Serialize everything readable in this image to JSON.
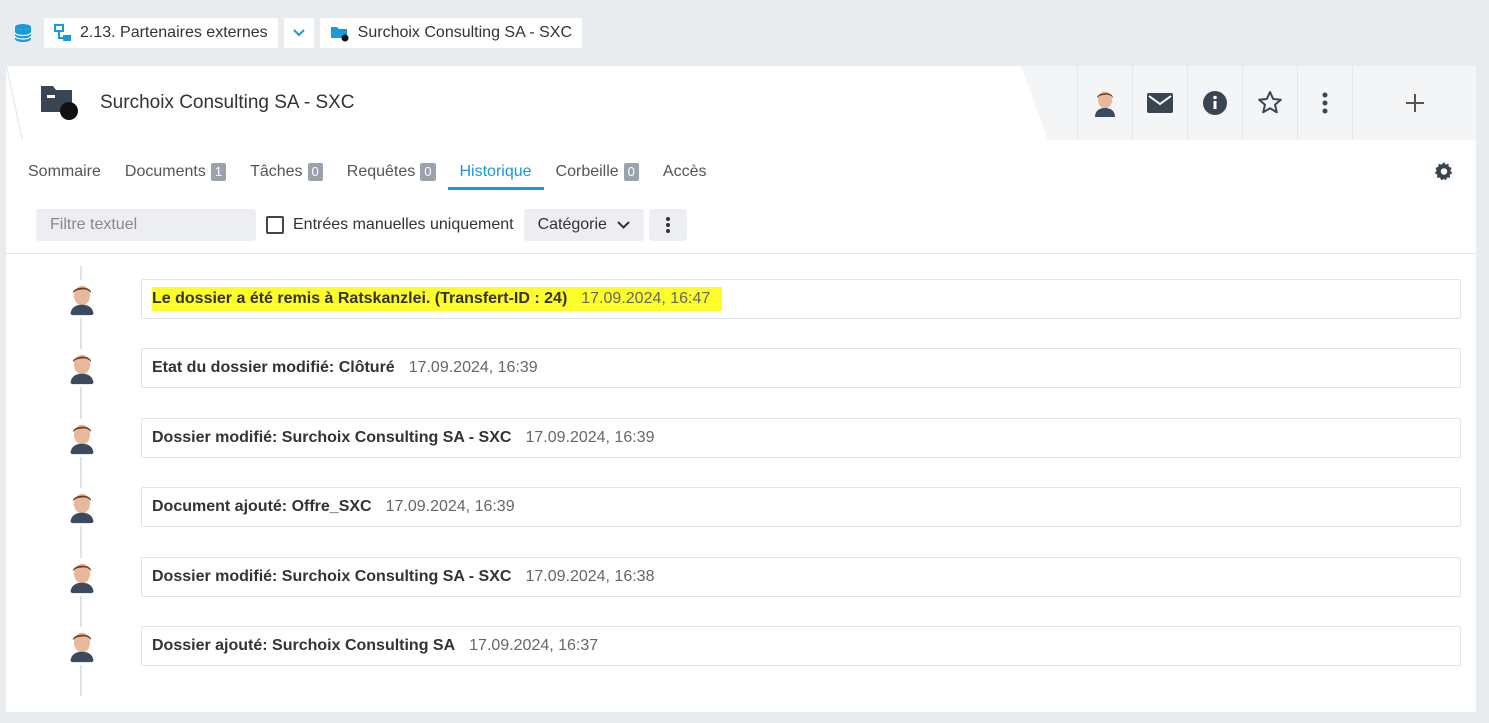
{
  "breadcrumb": {
    "items": [
      {
        "label": "2.13. Partenaires externes"
      },
      {
        "label": "Surchoix Consulting SA - SXC"
      }
    ]
  },
  "header": {
    "title": "Surchoix Consulting SA - SXC"
  },
  "tabs": [
    {
      "label": "Sommaire",
      "count": null
    },
    {
      "label": "Documents",
      "count": "1"
    },
    {
      "label": "Tâches",
      "count": "0"
    },
    {
      "label": "Requêtes",
      "count": "0"
    },
    {
      "label": "Historique",
      "count": null,
      "active": true
    },
    {
      "label": "Corbeille",
      "count": "0"
    },
    {
      "label": "Accès",
      "count": null
    }
  ],
  "filters": {
    "text_placeholder": "Filtre textuel",
    "manual_only_label": "Entrées manuelles uniquement",
    "category_label": "Catégorie"
  },
  "history": [
    {
      "text": "Le dossier a été remis à Ratskanzlei. (Transfert-ID : 24)",
      "time": "17.09.2024, 16:47",
      "highlighted": true
    },
    {
      "text": "Etat du dossier modifié: Clôturé",
      "time": "17.09.2024, 16:39"
    },
    {
      "text": "Dossier modifié: Surchoix Consulting SA - SXC",
      "time": "17.09.2024, 16:39"
    },
    {
      "text": "Document ajouté: Offre_SXC",
      "time": "17.09.2024, 16:39"
    },
    {
      "text": "Dossier modifié: Surchoix Consulting SA - SXC",
      "time": "17.09.2024, 16:38"
    },
    {
      "text": "Dossier ajouté: Surchoix Consulting SA",
      "time": "17.09.2024, 16:37"
    }
  ],
  "colors": {
    "accent": "#1a9ad6",
    "highlight": "#fdfd2a",
    "badge": "#9aa3ad"
  }
}
